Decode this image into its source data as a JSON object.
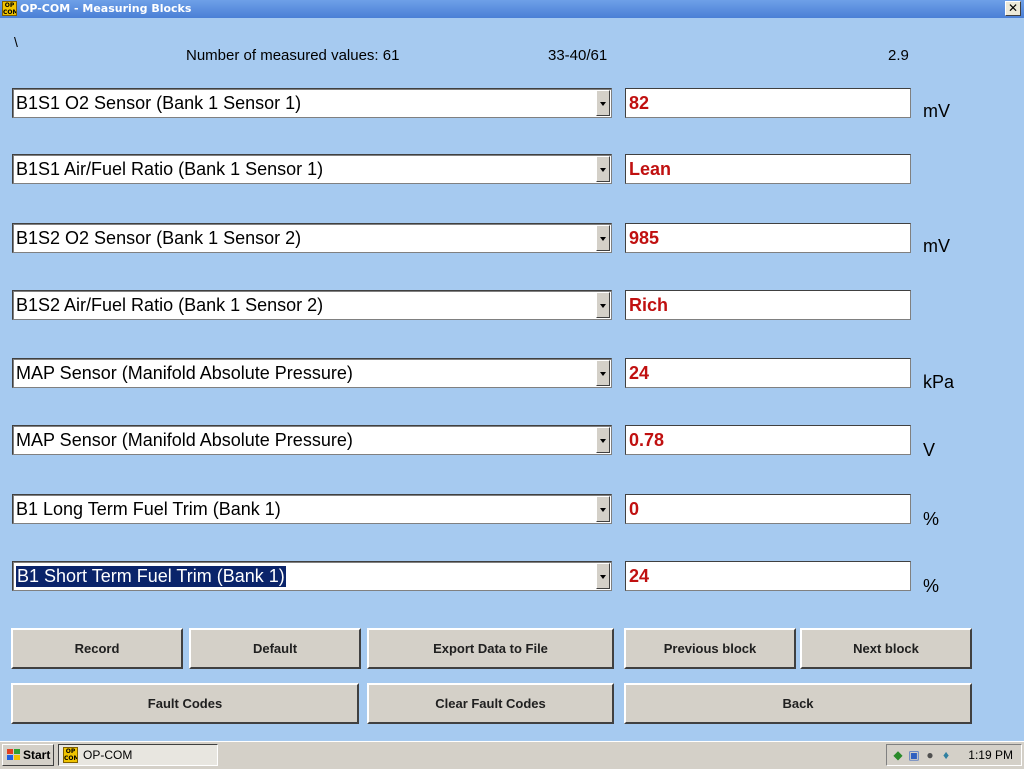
{
  "window": {
    "title": "OP-COM - Measuring Blocks",
    "icon": "OP COM",
    "close": "✕"
  },
  "info": {
    "prefix": "\\",
    "count_label": "Number of measured values: 61",
    "range": "33-40/61",
    "version": "2.9"
  },
  "rows": [
    {
      "label": "B1S1 O2 Sensor (Bank 1 Sensor 1)",
      "value": "82",
      "unit": "mV"
    },
    {
      "label": "B1S1 Air/Fuel Ratio (Bank 1 Sensor 1)",
      "value": "Lean",
      "unit": ""
    },
    {
      "label": "B1S2 O2 Sensor (Bank 1 Sensor 2)",
      "value": "985",
      "unit": "mV"
    },
    {
      "label": "B1S2 Air/Fuel Ratio (Bank 1 Sensor 2)",
      "value": "Rich",
      "unit": ""
    },
    {
      "label": "MAP Sensor (Manifold Absolute Pressure)",
      "value": "24",
      "unit": "kPa"
    },
    {
      "label": "MAP Sensor (Manifold Absolute Pressure)",
      "value": "0.78",
      "unit": "V"
    },
    {
      "label": "B1 Long Term Fuel Trim (Bank 1)",
      "value": "0",
      "unit": "%"
    },
    {
      "label": "B1 Short Term Fuel Trim (Bank 1)",
      "value": "24",
      "unit": "%"
    }
  ],
  "buttons": {
    "record": "Record",
    "default": "Default",
    "export": "Export Data to File",
    "previous": "Previous block",
    "next": "Next block",
    "fault_codes": "Fault Codes",
    "clear_fault_codes": "Clear Fault Codes",
    "back": "Back"
  },
  "taskbar": {
    "start": "Start",
    "task": "OP-COM",
    "task_icon": "OP COM",
    "clock": "1:19 PM"
  },
  "colors": {
    "background": "#a6caf0",
    "value_text": "#c01010",
    "selection": "#0a246a"
  }
}
